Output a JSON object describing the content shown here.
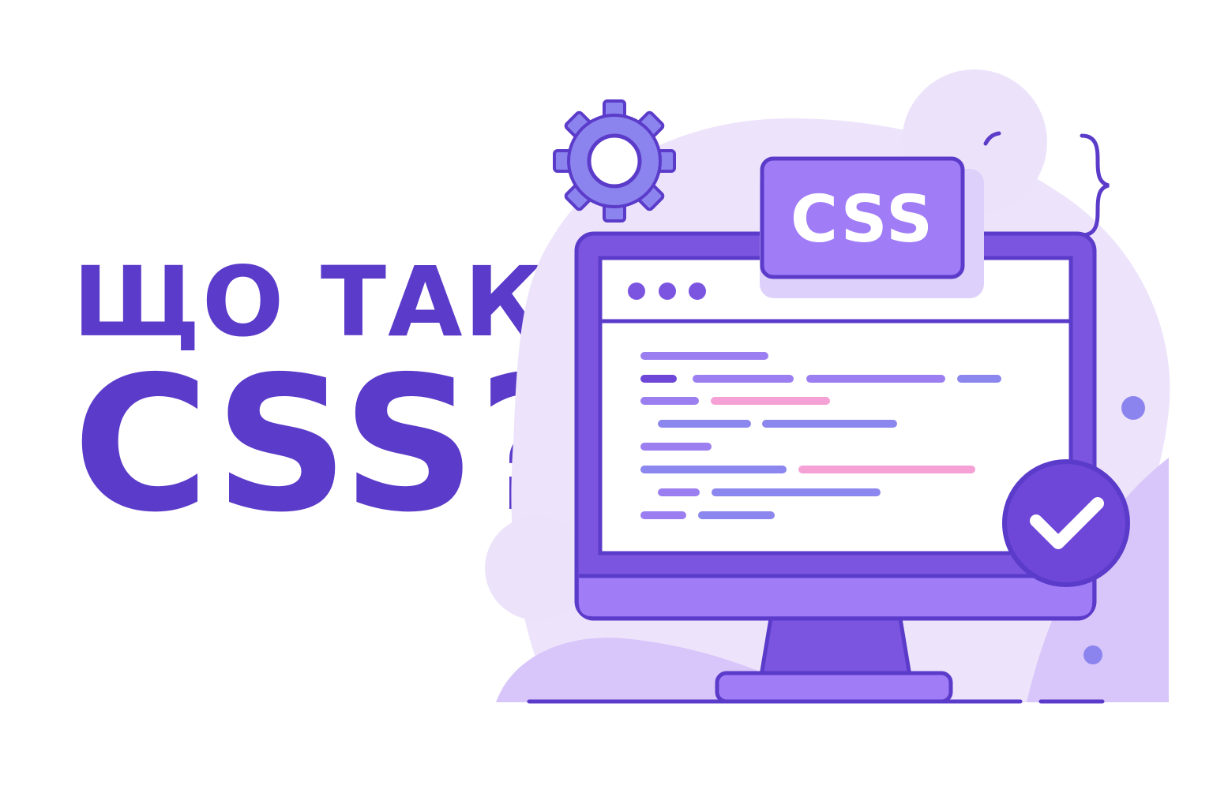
{
  "headline": {
    "line1": "ЩО ТАКЕ",
    "line2": "CSS?"
  },
  "badge": {
    "label": "CSS"
  },
  "icons": [
    "gear-icon",
    "check-icon",
    "curly-brace-icon",
    "window-dots-icon"
  ],
  "colors": {
    "primary": "#5b3bc9",
    "monitor": "#7b55e0",
    "accent_light": "#ede4fb",
    "code_purple": "#9b7ff0",
    "code_blue": "#8b87ee",
    "code_pink": "#f6a1d6",
    "badge": "#a07cf6",
    "check_badge": "#6e47d8"
  }
}
